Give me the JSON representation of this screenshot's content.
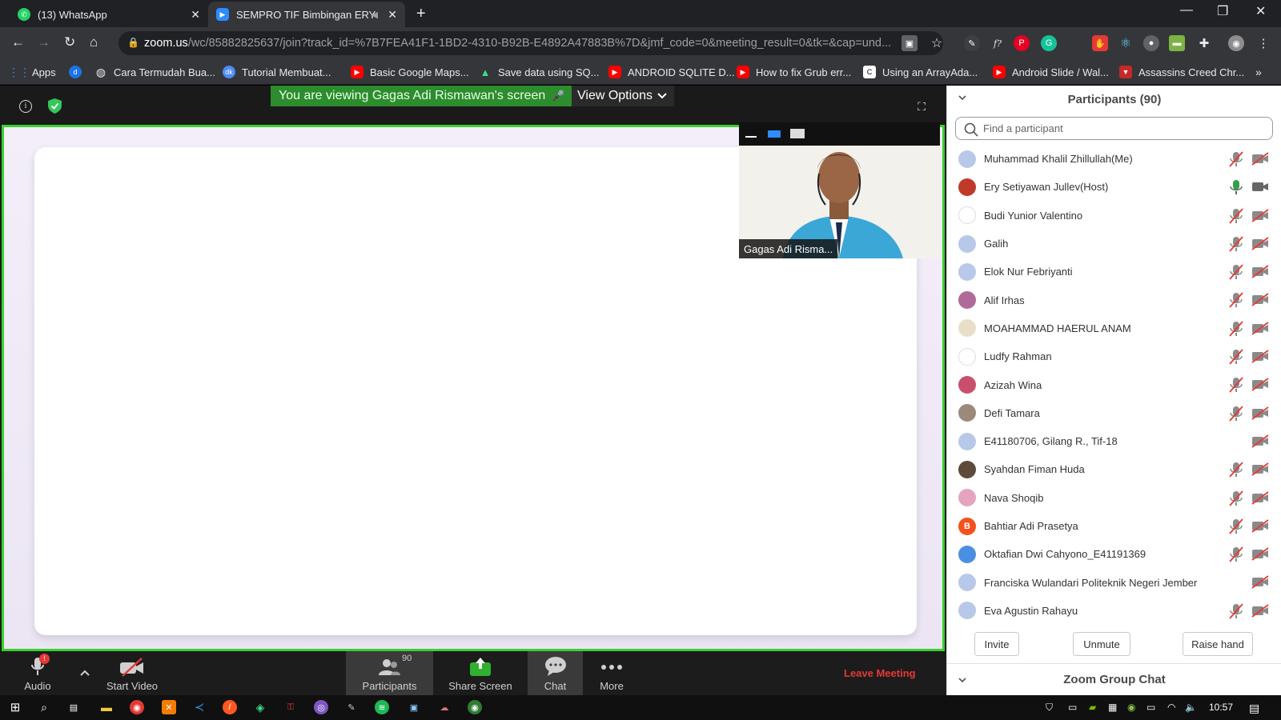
{
  "browser": {
    "tabs": [
      {
        "title": "(13) WhatsApp",
        "icon": "whatsapp-icon"
      },
      {
        "title": "SEMPRO TIF Bimbingan ERY",
        "icon": "zoom-icon"
      }
    ],
    "url_host": "zoom.us",
    "url_path": "/wc/85882825637/join?track_id=%7B7FEA41F1-1BD2-4310-B92B-E4892A47883B%7D&jmf_code=0&meeting_result=0&tk=&cap=und...",
    "bookmarks": [
      {
        "label": "Apps",
        "icon": "apps-grid-icon",
        "color": "#4285f4"
      },
      {
        "label": "Cara Termudah Bua...",
        "icon": "globe-icon",
        "color": "#9aa0a6"
      },
      {
        "label": "Tutorial Membuat...",
        "icon": "dk-icon",
        "color": "#1a73e8"
      },
      {
        "label": "Basic Google Maps...",
        "icon": "youtube-icon",
        "color": "#ff0000"
      },
      {
        "label": "Save data using SQ...",
        "icon": "android-icon",
        "color": "#3ddc84"
      },
      {
        "label": "ANDROID SQLITE D...",
        "icon": "youtube-icon",
        "color": "#ff0000"
      },
      {
        "label": "How to fix Grub err...",
        "icon": "youtube-icon",
        "color": "#ff0000"
      },
      {
        "label": "Using an ArrayAda...",
        "icon": "c-icon",
        "color": "#ffffff"
      },
      {
        "label": "Android Slide / Wal...",
        "icon": "youtube-icon",
        "color": "#ff0000"
      },
      {
        "label": "Assassins Creed Chr...",
        "icon": "assassins-icon",
        "color": "#c62828"
      }
    ]
  },
  "meeting": {
    "viewing_banner": "You are viewing Gagas Adi Rismawan's screen",
    "view_options": "View Options",
    "video_label": "Gagas Adi Risma..."
  },
  "controls": {
    "audio": "Audio",
    "audio_badge": "!",
    "start_video": "Start Video",
    "participants": "Participants",
    "participants_count": "90",
    "share_screen": "Share Screen",
    "chat": "Chat",
    "more": "More",
    "leave": "Leave Meeting"
  },
  "panel": {
    "title": "Participants (90)",
    "search_placeholder": "Find a participant",
    "participants": [
      {
        "name": "Muhammad Khalil Zhillullah(Me)",
        "avatar": "#b8c8e8",
        "mic": "muted",
        "cam": "off"
      },
      {
        "name": "Ery Setiyawan Jullev(Host)",
        "avatar": "#c0392b",
        "mic": "on",
        "cam": "on"
      },
      {
        "name": "Budi Yunior Valentino",
        "avatar": "#ffffff",
        "mic": "muted",
        "cam": "off"
      },
      {
        "name": "Galih",
        "avatar": "#b8c8e8",
        "mic": "muted",
        "cam": "off"
      },
      {
        "name": "Elok Nur Febriyanti",
        "avatar": "#b8c8e8",
        "mic": "muted",
        "cam": "off"
      },
      {
        "name": "Alif Irhas",
        "avatar": "#b06a9a",
        "mic": "muted",
        "cam": "off"
      },
      {
        "name": "MOAHAMMAD HAERUL ANAM",
        "avatar": "#e9dfc9",
        "mic": "muted",
        "cam": "off"
      },
      {
        "name": "Ludfy Rahman",
        "avatar": "#ffffff",
        "mic": "muted",
        "cam": "off"
      },
      {
        "name": "Azizah Wina",
        "avatar": "#c94f6d",
        "mic": "muted",
        "cam": "off"
      },
      {
        "name": "Defi Tamara",
        "avatar": "#9b8a7a",
        "mic": "muted",
        "cam": "off"
      },
      {
        "name": "E41180706, Gilang R., Tif-18",
        "avatar": "#b8c8e8",
        "mic": "none",
        "cam": "off"
      },
      {
        "name": "Syahdan Fiman Huda",
        "avatar": "#5d4a3a",
        "mic": "muted",
        "cam": "off"
      },
      {
        "name": "Nava Shoqib",
        "avatar": "#e6a3c0",
        "mic": "muted",
        "cam": "off"
      },
      {
        "name": "Bahtiar Adi Prasetya",
        "avatar": "#f4511e",
        "initial": "B",
        "mic": "muted",
        "cam": "off"
      },
      {
        "name": "Oktafian Dwi Cahyono_E41191369",
        "avatar": "#4a90e2",
        "mic": "muted",
        "cam": "off"
      },
      {
        "name": "Franciska Wulandari Politeknik Negeri Jember",
        "avatar": "#b8c8e8",
        "mic": "none",
        "cam": "off"
      },
      {
        "name": "Eva Agustin Rahayu",
        "avatar": "#b8c8e8",
        "mic": "muted",
        "cam": "off"
      }
    ],
    "invite": "Invite",
    "unmute": "Unmute",
    "raise_hand": "Raise hand",
    "chat_title": "Zoom Group Chat"
  },
  "taskbar": {
    "time": "10:57"
  }
}
